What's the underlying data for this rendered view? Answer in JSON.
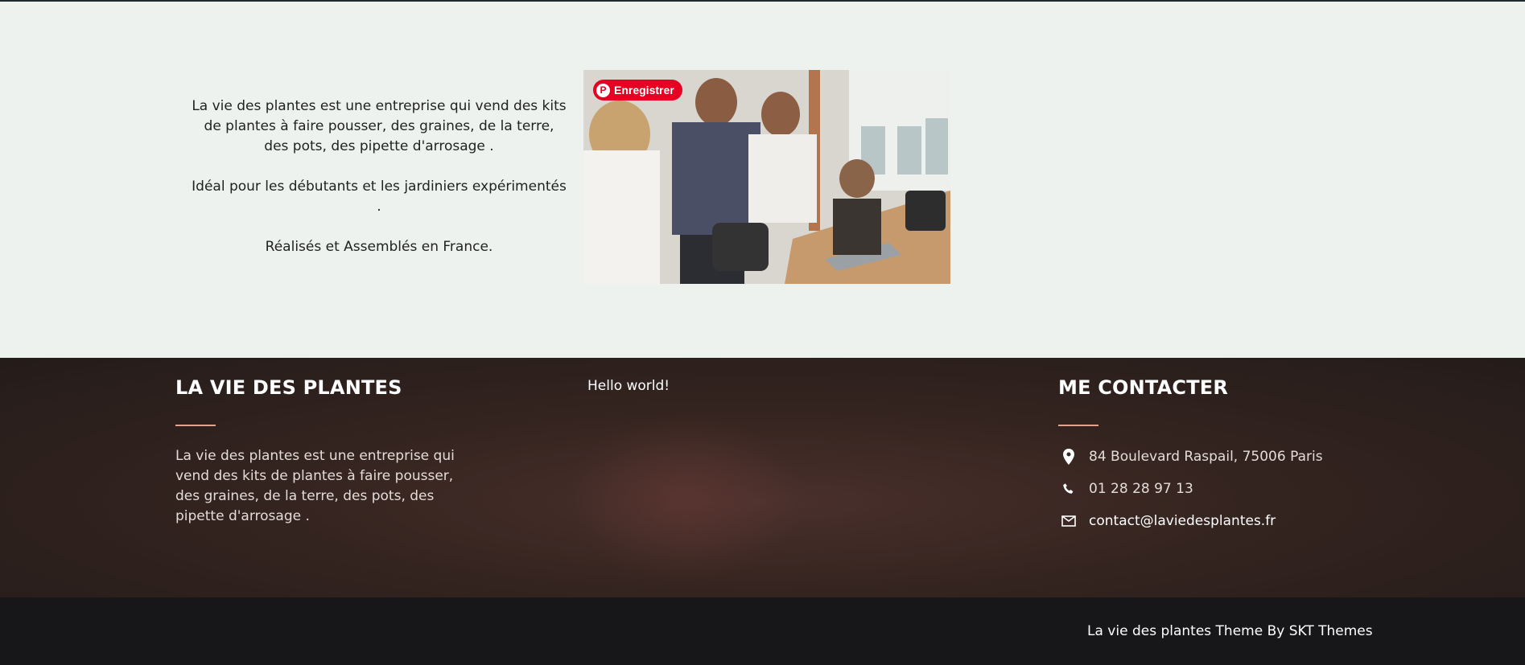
{
  "about": {
    "paragraphs": [
      "La vie des plantes est une entreprise qui vend des kits de plantes à faire pousser, des graines, de la terre, des pots, des pipette d'arrosage .",
      "Idéal pour les débutants et les jardiniers expérimentés .",
      "Réalisés et Assemblés en France."
    ],
    "pinterest_label": "Enregistrer",
    "pinterest_icon": "pinterest-icon"
  },
  "footer": {
    "col1": {
      "title": "LA VIE DES PLANTES",
      "description": "La vie des plantes est une entreprise qui vend des kits de plantes à faire pousser, des graines, de la terre, des pots, des pipette d'arrosage ."
    },
    "col2": {
      "link": "Hello world!"
    },
    "col3": {
      "title": "ME CONTACTER",
      "address": "84 Boulevard Raspail, 75006 Paris",
      "phone": "01 28 28 97 13",
      "email": "contact@laviedesplantes.fr",
      "icons": [
        "map-pin-icon",
        "phone-icon",
        "envelope-icon"
      ]
    },
    "accent_color": "#e0a38f",
    "credit": "La vie des plantes Theme By SKT Themes"
  },
  "colors": {
    "section_bg": "#edf2ee",
    "footer_bg": "#2a201d",
    "bottom_bar_bg": "#171719",
    "pinterest_red": "#e60023"
  }
}
